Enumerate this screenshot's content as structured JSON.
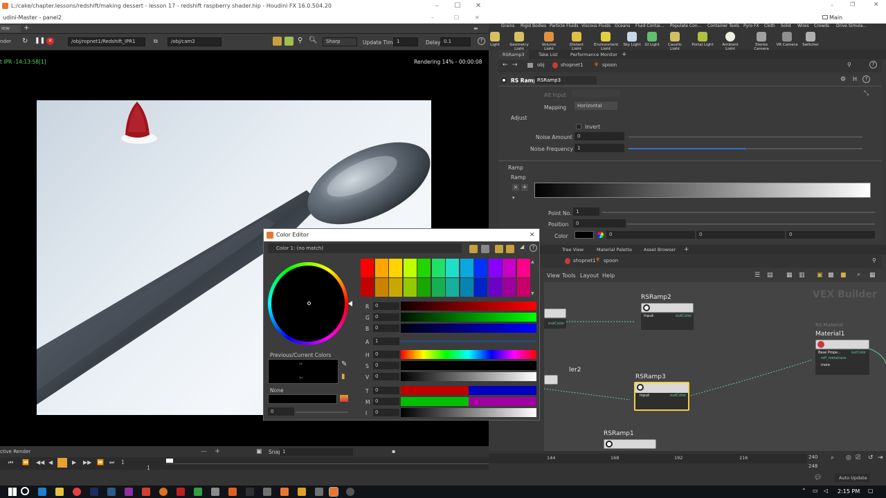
{
  "window": {
    "title": "L:/cake/chapter.lessons/redshift/making dessert - lesson 17 - redshift raspberry shader.hip - Houdini FX 16.0.504.20",
    "minimize": "–",
    "maximize": "☐",
    "close": "✕",
    "subtitle": "udini-Master - panel2",
    "menu_left": "iew",
    "menu_plus": "+"
  },
  "viewer": {
    "render_label": "nder",
    "path_field": "/obj/ropnet1/Redshift_IPR1",
    "camera_field": "/obj/cam2",
    "mode_select": "Sharp",
    "update_label": "Update Time",
    "update_value": "1",
    "delay_label": "Delay",
    "delay_value": "0.1",
    "ipr_label": "t IPR -14:13:58[1]",
    "rendering_status": "Rendering 14% - 00:00:08"
  },
  "timeline": {
    "active_render": "ctive Render",
    "snap_label": "Snap",
    "snap_value": "1",
    "frame": "1",
    "frame2": "1",
    "ticks": [
      "144",
      "168",
      "192",
      "216"
    ],
    "end_a": "240",
    "end_b": "248",
    "auto_update": "Auto Update"
  },
  "top_right": {
    "main_label": "Main",
    "shelf_tabs": [
      "Grains",
      "Rigid Bodies",
      "Particle Fluids",
      "Viscous Fluids",
      "Oceans",
      "Fluid Contai...",
      "Populate Con...",
      "Container Tools",
      "Pyro FX",
      "Cloth",
      "Solid",
      "Wires",
      "Crowds",
      "Drive Simula..."
    ],
    "shelf_items": [
      "Light",
      "Geometry Light",
      "Volume Light",
      "Distant Light",
      "Environment Light",
      "Sky Light",
      "GI Light",
      "Caustic Light",
      "Portal Light",
      "Ambient Light",
      "Stereo Camera",
      "VR Camera",
      "Switcher"
    ]
  },
  "param_pane": {
    "tabs": [
      "RSRamp3",
      "Take List",
      "Performance Monitor"
    ],
    "path_obj": "obj",
    "path_shopnet": "shopnet1",
    "path_spoon": "spoon",
    "node_type": "RS Ramp",
    "node_name": "RSRamp3",
    "alt_input": "Alt Input",
    "mapping_label": "Mapping",
    "mapping_value": "Horizontal",
    "adjust_label": "Adjust",
    "invert_label": "Invert",
    "noise_amount_label": "Noise Amount",
    "noise_amount_value": "0",
    "noise_amount_level": 0.0,
    "noise_freq_label": "Noise Frequency",
    "noise_freq_value": "1",
    "noise_freq_level": 0.5,
    "ramp_section": "Ramp",
    "ramp_label": "Ramp",
    "point_no_label": "Point No.",
    "point_no_value": "1",
    "position_label": "Position",
    "position_value": "0",
    "color_label": "Color",
    "color_r": "0",
    "color_g": "0",
    "color_b": "0"
  },
  "network_pane": {
    "tabs": [
      "Tree View",
      "Material Palette",
      "Asset Browser"
    ],
    "path_shopnet": "shopnet1",
    "path_spoon": "spoon",
    "menu": [
      "View",
      "Tools",
      "Layout",
      "Help"
    ],
    "vex_builder": "VEX Builder",
    "nodes": {
      "rsramp2": "RSRamp2",
      "rsramp3": "RSRamp3",
      "rsramp1": "RSRamp1",
      "material1": "Material1",
      "rs_material": "RS Material",
      "ler2": "ler2",
      "input": "Input",
      "outcolor": "outColor",
      "base_props": "Base Prope...",
      "refl_metalness": "refl_metalness",
      "more": "more"
    }
  },
  "color_editor": {
    "title": "Color Editor",
    "close": "✕",
    "color_select": "Color 1: (no match)",
    "prev_current_label": "Previous/Current Colors",
    "none_label": "None",
    "none_value": "0",
    "channels": [
      {
        "label": "R",
        "value": "0"
      },
      {
        "label": "G",
        "value": "0"
      },
      {
        "label": "B",
        "value": "0"
      },
      {
        "label": "A",
        "value": "1"
      },
      {
        "label": "H",
        "value": "0"
      },
      {
        "label": "S",
        "value": "0"
      },
      {
        "label": "V",
        "value": "0"
      },
      {
        "label": "T",
        "value": "0"
      },
      {
        "label": "M",
        "value": "0"
      },
      {
        "label": "I",
        "value": "0"
      }
    ],
    "swatches_top": [
      "#ff0000",
      "#ffa500",
      "#ffd400",
      "#bfff00",
      "#22d400",
      "#1ee06a",
      "#1ee0c8",
      "#0aa8e0",
      "#0033ff",
      "#8a00ff",
      "#c800c8",
      "#ff0088"
    ],
    "swatches_bottom": [
      "#c40000",
      "#c88400",
      "#c8a800",
      "#96c800",
      "#18a800",
      "#16b052",
      "#16b09c",
      "#0884b0",
      "#0022c8",
      "#6c00c8",
      "#9c009c",
      "#c8006a"
    ]
  },
  "taskbar": {
    "time": "2:15 PM"
  },
  "colors": {
    "accent": "#e8772e",
    "node_selected": "#f0d040",
    "wire": "#6fc896"
  }
}
